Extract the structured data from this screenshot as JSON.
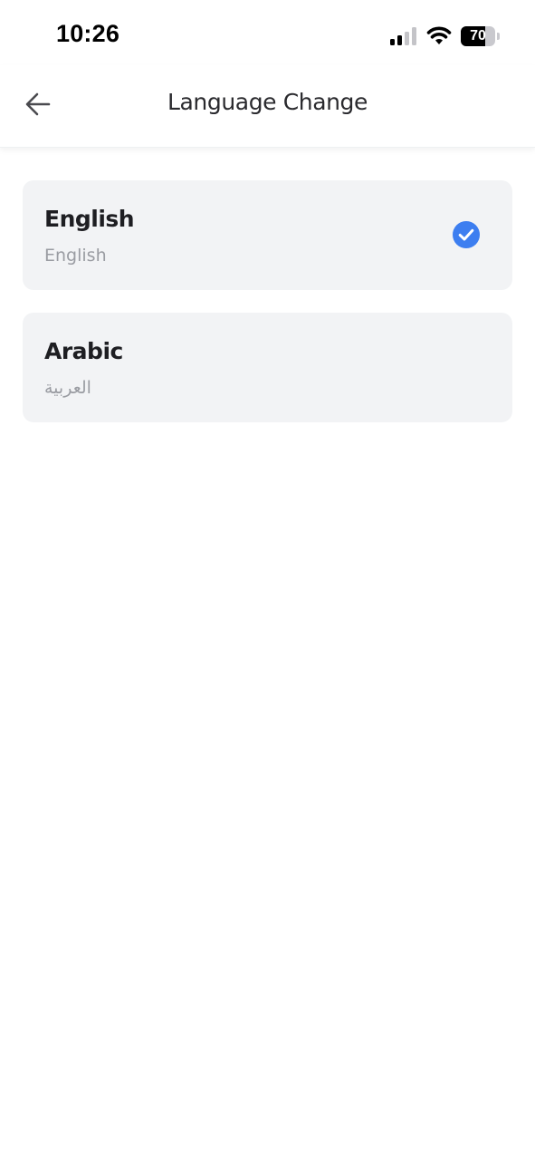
{
  "status_bar": {
    "time": "10:26",
    "battery_level": "70",
    "battery_fraction": 0.7,
    "icons": [
      "signal-icon",
      "wifi-icon",
      "battery-icon"
    ]
  },
  "header": {
    "title": "Language Change",
    "back_icon": "arrow-left-icon"
  },
  "languages": [
    {
      "name": "English",
      "native": "English",
      "selected": true
    },
    {
      "name": "Arabic",
      "native": "العربية",
      "selected": false
    }
  ],
  "colors": {
    "accent": "#3d7ef0",
    "card_background": "#f2f3f5",
    "title_text": "#2a2a2e",
    "secondary_text": "#9a9ca2"
  }
}
